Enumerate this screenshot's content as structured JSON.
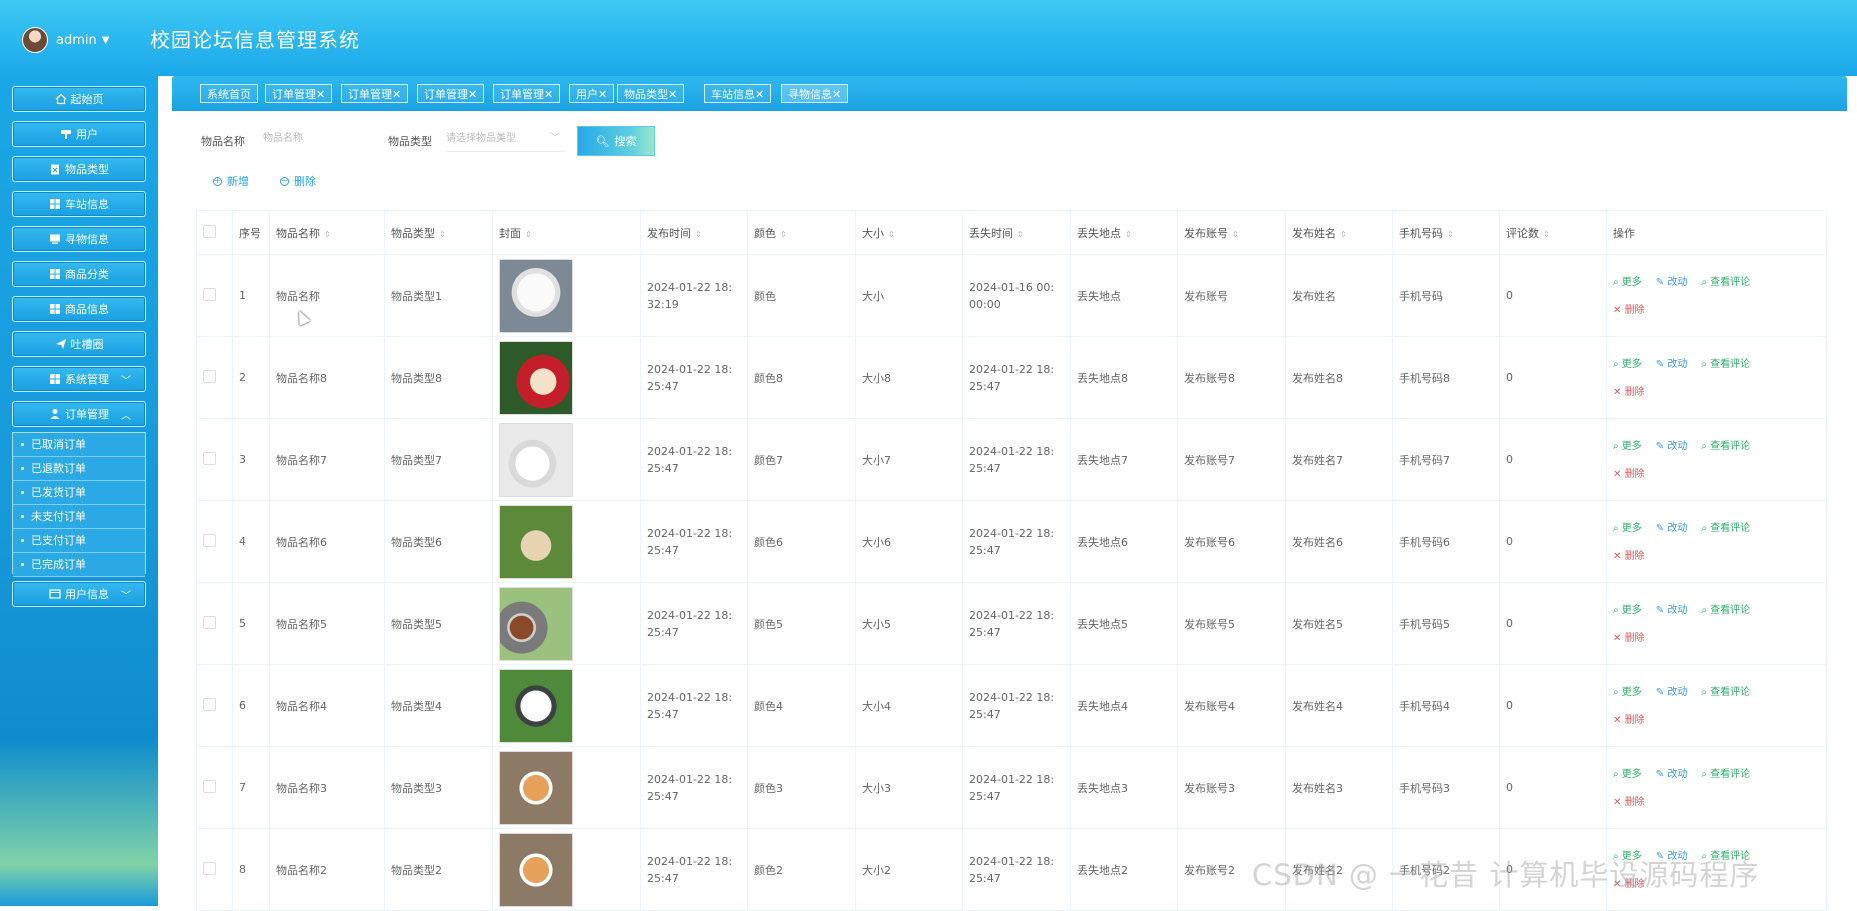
{
  "header": {
    "user": "admin",
    "title": "校园论坛信息管理系统"
  },
  "sidebar": {
    "items": [
      {
        "label": "起始页"
      },
      {
        "label": "用户"
      },
      {
        "label": "物品类型"
      },
      {
        "label": "车站信息"
      },
      {
        "label": "寻物信息"
      },
      {
        "label": "商品分类"
      },
      {
        "label": "商品信息"
      },
      {
        "label": "吐槽圈"
      },
      {
        "label": "系统管理"
      },
      {
        "label": "订单管理"
      },
      {
        "label": "用户信息"
      }
    ],
    "order_sub": [
      "已取消订单",
      "已退款订单",
      "已发货订单",
      "未支付订单",
      "已支付订单",
      "已完成订单"
    ]
  },
  "tabs": [
    "系统首页",
    "订单管理✕",
    "订单管理✕",
    "订单管理✕",
    "订单管理✕",
    "用户✕",
    "物品类型✕",
    "车站信息✕",
    "寻物信息✕"
  ],
  "filters": {
    "name_label": "物品名称",
    "name_placeholder": "物品名称",
    "type_label": "物品类型",
    "type_placeholder": "请选择物品类型",
    "search_label": "搜索",
    "add_label": "新增",
    "delete_label": "删除"
  },
  "table": {
    "headers": [
      "序号",
      "物品名称",
      "物品类型",
      "封面",
      "发布时间",
      "颜色",
      "大小",
      "丢失时间",
      "丢失地点",
      "发布账号",
      "发布姓名",
      "手机号码",
      "评论数",
      "操作"
    ],
    "rows": [
      {
        "no": "1",
        "name": "物品名称",
        "type": "物品类型1",
        "pub1": "2024-01-22 18:",
        "pub2": "32:19",
        "color": "颜色",
        "size": "大小",
        "lost1": "2024-01-16 00:",
        "lost2": "00:00",
        "place": "丢失地点",
        "acct": "发布账号",
        "pname": "发布姓名",
        "phone": "手机号码",
        "comments": "0"
      },
      {
        "no": "2",
        "name": "物品名称8",
        "type": "物品类型8",
        "pub1": "2024-01-22 18:",
        "pub2": "25:47",
        "color": "颜色8",
        "size": "大小8",
        "lost1": "2024-01-22 18:",
        "lost2": "25:47",
        "place": "丢失地点8",
        "acct": "发布账号8",
        "pname": "发布姓名8",
        "phone": "手机号码8",
        "comments": "0"
      },
      {
        "no": "3",
        "name": "物品名称7",
        "type": "物品类型7",
        "pub1": "2024-01-22 18:",
        "pub2": "25:47",
        "color": "颜色7",
        "size": "大小7",
        "lost1": "2024-01-22 18:",
        "lost2": "25:47",
        "place": "丢失地点7",
        "acct": "发布账号7",
        "pname": "发布姓名7",
        "phone": "手机号码7",
        "comments": "0"
      },
      {
        "no": "4",
        "name": "物品名称6",
        "type": "物品类型6",
        "pub1": "2024-01-22 18:",
        "pub2": "25:47",
        "color": "颜色6",
        "size": "大小6",
        "lost1": "2024-01-22 18:",
        "lost2": "25:47",
        "place": "丢失地点6",
        "acct": "发布账号6",
        "pname": "发布姓名6",
        "phone": "手机号码6",
        "comments": "0"
      },
      {
        "no": "5",
        "name": "物品名称5",
        "type": "物品类型5",
        "pub1": "2024-01-22 18:",
        "pub2": "25:47",
        "color": "颜色5",
        "size": "大小5",
        "lost1": "2024-01-22 18:",
        "lost2": "25:47",
        "place": "丢失地点5",
        "acct": "发布账号5",
        "pname": "发布姓名5",
        "phone": "手机号码5",
        "comments": "0"
      },
      {
        "no": "6",
        "name": "物品名称4",
        "type": "物品类型4",
        "pub1": "2024-01-22 18:",
        "pub2": "25:47",
        "color": "颜色4",
        "size": "大小4",
        "lost1": "2024-01-22 18:",
        "lost2": "25:47",
        "place": "丢失地点4",
        "acct": "发布账号4",
        "pname": "发布姓名4",
        "phone": "手机号码4",
        "comments": "0"
      },
      {
        "no": "7",
        "name": "物品名称3",
        "type": "物品类型3",
        "pub1": "2024-01-22 18:",
        "pub2": "25:47",
        "color": "颜色3",
        "size": "大小3",
        "lost1": "2024-01-22 18:",
        "lost2": "25:47",
        "place": "丢失地点3",
        "acct": "发布账号3",
        "pname": "发布姓名3",
        "phone": "手机号码3",
        "comments": "0"
      },
      {
        "no": "8",
        "name": "物品名称2",
        "type": "物品类型2",
        "pub1": "2024-01-22 18:",
        "pub2": "25:47",
        "color": "颜色2",
        "size": "大小2",
        "lost1": "2024-01-22 18:",
        "lost2": "25:47",
        "place": "丢失地点2",
        "acct": "发布账号2",
        "pname": "发布姓名2",
        "phone": "手机号码2",
        "comments": "0"
      }
    ],
    "ops": {
      "more": "更多",
      "edit": "改动",
      "view_comments": "查看评论",
      "delete": "删除"
    }
  },
  "watermark": "CSDN @ 一花昔 计算机毕设源码程序",
  "colors": {
    "header": "#1aa8e8",
    "sidebar": "#1798d9",
    "accent": "#2aa0e6",
    "op_green": "#2fae6a",
    "op_red": "#e25a5a"
  }
}
